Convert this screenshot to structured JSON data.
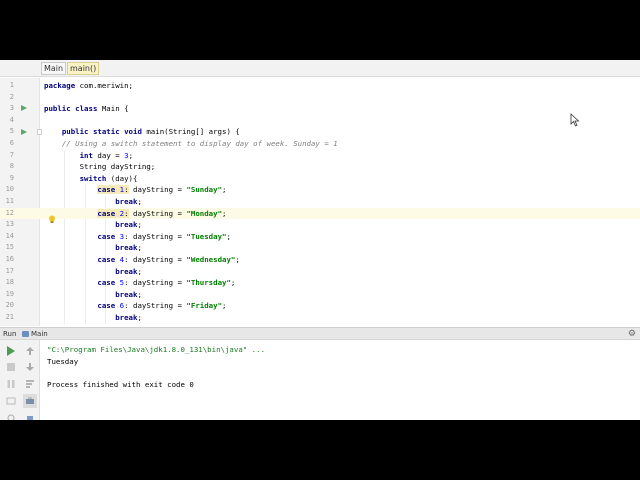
{
  "breadcrumb": {
    "items": [
      "Main",
      "main()"
    ]
  },
  "editor": {
    "lines": [
      {
        "n": "1",
        "code": "<span class=\"kw\">package</span> com.meriwin;"
      },
      {
        "n": "2",
        "code": ""
      },
      {
        "n": "3",
        "code": "<span class=\"kw\">public class</span> Main {",
        "run": true
      },
      {
        "n": "4",
        "code": ""
      },
      {
        "n": "5",
        "code": "    <span class=\"kw\">public static void</span> main(String[] args) {",
        "run": true,
        "fold": true
      },
      {
        "n": "6",
        "code": "    <span class=\"cmt\">// Using a switch statement to display day of week. Sunday = 1</span>"
      },
      {
        "n": "7",
        "code": "        <span class=\"kw\">int</span> day = <span class=\"num\">3</span>;"
      },
      {
        "n": "8",
        "code": "        String dayString;"
      },
      {
        "n": "9",
        "code": "        <span class=\"kw\">switch</span> (day){"
      },
      {
        "n": "10",
        "code": "            <span class=\"kw hlw\">case</span><span class=\"hlw\"> </span><span class=\"num hlw\">1</span><span class=\"hlw\">:</span> dayString = <span class=\"str\">\"Sunday\"</span>;"
      },
      {
        "n": "11",
        "code": "                <span class=\"kw\">break</span>;"
      },
      {
        "n": "12",
        "code": "            <span class=\"kw hlw\">case</span><span class=\"hlw\"> </span><span class=\"num hlw\">2</span><span class=\"hlw\">:</span> dayString = <span class=\"str\">\"Monday\"</span>;",
        "hl": true,
        "bulb": true
      },
      {
        "n": "13",
        "code": "                <span class=\"kw\">break</span>;"
      },
      {
        "n": "14",
        "code": "            <span class=\"kw\">case</span> <span class=\"num\">3</span>: dayString = <span class=\"str\">\"Tuesday\"</span>;"
      },
      {
        "n": "15",
        "code": "                <span class=\"kw\">break</span>;"
      },
      {
        "n": "16",
        "code": "            <span class=\"kw\">case</span> <span class=\"num\">4</span>: dayString = <span class=\"str\">\"Wednesday\"</span>;"
      },
      {
        "n": "17",
        "code": "                <span class=\"kw\">break</span>;"
      },
      {
        "n": "18",
        "code": "            <span class=\"kw\">case</span> <span class=\"num\">5</span>: dayString = <span class=\"str\">\"Thursday\"</span>;"
      },
      {
        "n": "19",
        "code": "                <span class=\"kw\">break</span>;"
      },
      {
        "n": "20",
        "code": "            <span class=\"kw\">case</span> <span class=\"num\">6</span>: dayString = <span class=\"str\">\"Friday\"</span>;"
      },
      {
        "n": "21",
        "code": "                <span class=\"kw\">break</span>;"
      }
    ]
  },
  "run": {
    "label": "Run",
    "tab": "Main",
    "console": [
      {
        "cls": "cmdline",
        "text": "\"C:\\Program Files\\Java\\jdk1.8.0_131\\bin\\java\" ..."
      },
      {
        "cls": "out",
        "text": "Tuesday"
      },
      {
        "cls": "out",
        "text": ""
      },
      {
        "cls": "out",
        "text": "Process finished with exit code 0"
      }
    ]
  },
  "colors": {
    "accent_run": "#59a869",
    "line_highlight": "#fdfbe6",
    "keyword": "#000080",
    "string": "#008000"
  }
}
